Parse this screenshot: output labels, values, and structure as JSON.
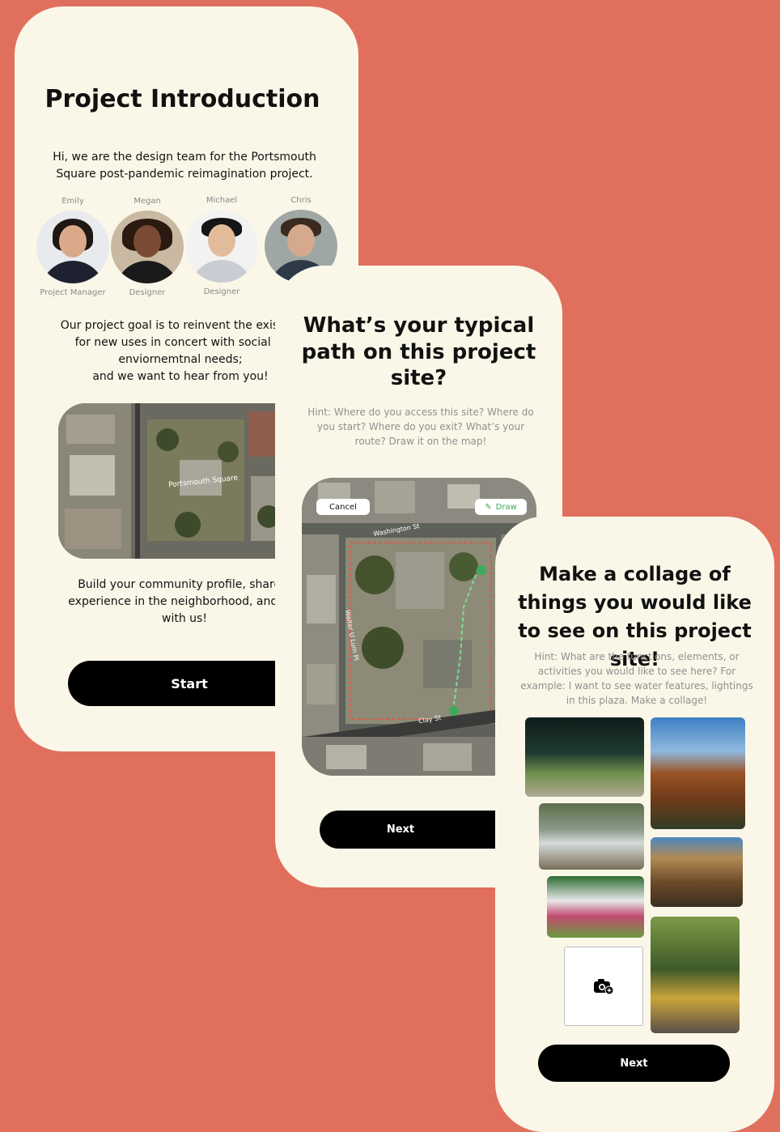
{
  "colors": {
    "background": "#E0705D",
    "card": "#FBF7E8",
    "button": "#000000",
    "hint": "#8F8F8F",
    "draw_accent": "#3DAA5C"
  },
  "intro": {
    "title": "Project Introduction",
    "greeting": "Hi, we are the design team for the Portsmouth Square post-pandemic reimagination project.",
    "team": [
      {
        "name": "Emily",
        "role": "Project Manager"
      },
      {
        "name": "Megan",
        "role": "Designer"
      },
      {
        "name": "Michael",
        "role": "Designer"
      },
      {
        "name": "Chris",
        "role": ""
      }
    ],
    "goal_lines": [
      "Our project goal is to reinvent the existing",
      "for new uses in concert with social ar",
      "enviornemtnal needs;",
      "and we want to hear from you!"
    ],
    "map_label": "Portsmouth Square",
    "build_lines": [
      "Build your community profile, share y",
      "experience in the neighborhood, and coll",
      "with us!"
    ],
    "start_label": "Start"
  },
  "path": {
    "title": "What’s your typical path on this project site?",
    "hint": "Hint: Where do you access this site? Where do you start? Where do you exit? What’s your route? Draw it on the map!",
    "cancel_label": "Cancel",
    "draw_label": "Draw",
    "street_labels": [
      "Washington St",
      "Walter U Lum Pl",
      "Clay St"
    ],
    "next_label": "Next"
  },
  "collage": {
    "title": "Make a collage of things you would like to see on this project site!",
    "hint": "Hint: What are the functions, elements, or activities you would like to see here? For example: I want to see water features, lightings in this plaza. Make a collage!",
    "upload_icon": "camera-add-icon",
    "next_label": "Next"
  }
}
